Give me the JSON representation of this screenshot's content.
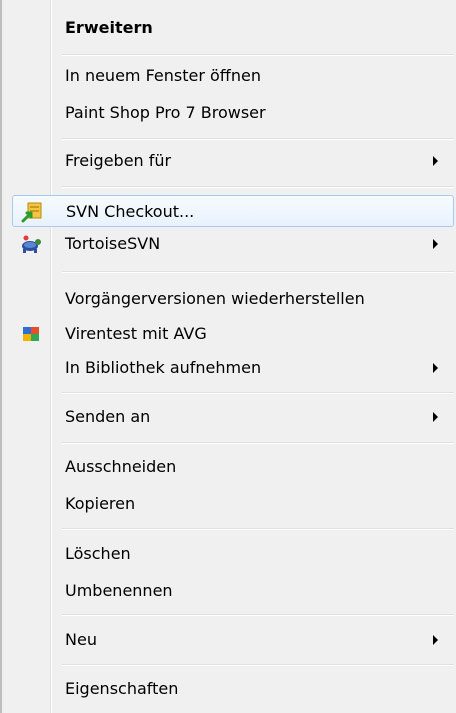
{
  "menu": {
    "items": [
      {
        "label": "Erweitern",
        "bold": true
      },
      {
        "label": "In neuem Fenster öffnen"
      },
      {
        "label": "Paint Shop Pro 7 Browser"
      },
      {
        "label": "Freigeben für",
        "submenu": true
      },
      {
        "label": "SVN Checkout...",
        "icon": "svn-checkout-icon",
        "highlighted": true
      },
      {
        "label": "TortoiseSVN",
        "icon": "tortoisesvn-icon",
        "submenu": true
      },
      {
        "label": "Vorgängerversionen wiederherstellen"
      },
      {
        "label": "Virentest mit AVG",
        "icon": "avg-icon"
      },
      {
        "label": "In Bibliothek aufnehmen",
        "submenu": true
      },
      {
        "label": "Senden an",
        "submenu": true
      },
      {
        "label": "Ausschneiden"
      },
      {
        "label": "Kopieren"
      },
      {
        "label": "Löschen"
      },
      {
        "label": "Umbenennen"
      },
      {
        "label": "Neu",
        "submenu": true
      },
      {
        "label": "Eigenschaften"
      }
    ]
  },
  "colors": {
    "menu_background": "#f0f0f0",
    "highlight_border": "#a8caf0",
    "highlight_fill": "#e8f2fd"
  }
}
